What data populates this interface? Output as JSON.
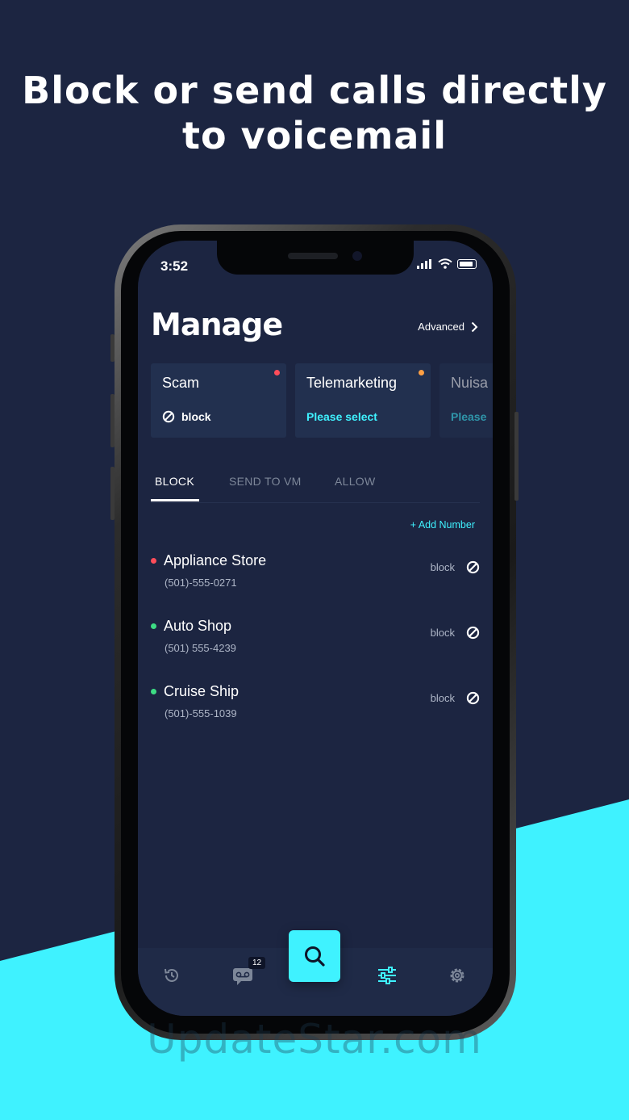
{
  "headline": {
    "line1": "Block or send calls directly",
    "line2": "to voicemail"
  },
  "watermark": "UpdateStar.com",
  "status_bar": {
    "time": "3:52"
  },
  "header": {
    "title": "Manage",
    "advanced_label": "Advanced"
  },
  "categories": [
    {
      "name": "Scam",
      "status": "block",
      "dot_color": "#ff4d5a"
    },
    {
      "name": "Telemarketing",
      "status": "Please select",
      "dot_color": "#ff9f43"
    },
    {
      "name": "Nuisa",
      "status": "Please",
      "dot_color": ""
    }
  ],
  "tabs": [
    {
      "label": "BLOCK",
      "active": true
    },
    {
      "label": "SEND TO VM",
      "active": false
    },
    {
      "label": "ALLOW",
      "active": false
    }
  ],
  "add_number_label": "+ Add Number",
  "contacts": [
    {
      "name": "Appliance Store",
      "phone": "(501)-555-0271",
      "action": "block",
      "dot_color": "#ff4d5a"
    },
    {
      "name": "Auto Shop",
      "phone": "(501) 555-4239",
      "action": "block",
      "dot_color": "#3ddc84"
    },
    {
      "name": "Cruise Ship",
      "phone": "(501)-555-1039",
      "action": "block",
      "dot_color": "#3ddc84"
    }
  ],
  "tabbar": {
    "voicemail_badge": "12",
    "icons": [
      "history-icon",
      "voicemail-icon",
      "search-icon",
      "filters-icon",
      "settings-icon"
    ]
  },
  "colors": {
    "accent": "#3ff2ff",
    "background": "#1c2541",
    "card": "#22304f"
  }
}
